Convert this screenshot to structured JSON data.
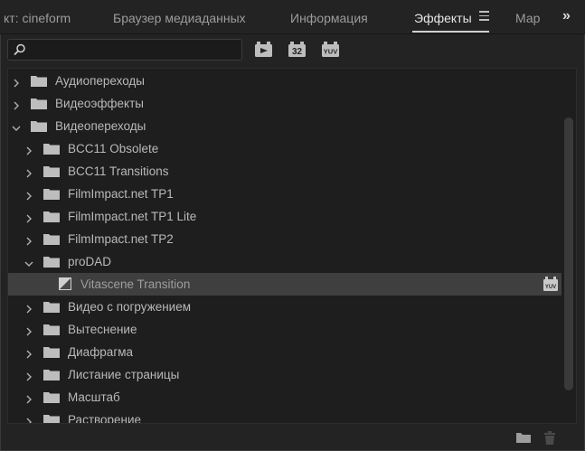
{
  "tabs": [
    {
      "label": "кт: cineform",
      "active": false
    },
    {
      "label": "Браузер медиаданных",
      "active": false
    },
    {
      "label": "Информация",
      "active": false
    },
    {
      "label": "Эффекты",
      "active": true
    },
    {
      "label": "Мар",
      "active": false
    }
  ],
  "more_tabs_glyph": "»",
  "search": {
    "value": "",
    "placeholder": ""
  },
  "toolbar": {
    "accelerated_icon": "accelerated-effects-icon",
    "bit32_label": "32",
    "yuv_label": "YUV"
  },
  "tree": [
    {
      "label": "Аудиопереходы",
      "expanded": false,
      "type": "folder"
    },
    {
      "label": "Видеоэффекты",
      "expanded": false,
      "type": "folder"
    },
    {
      "label": "Видеопереходы",
      "expanded": true,
      "type": "folder"
    },
    {
      "label": "BCC11 Obsolete",
      "expanded": false,
      "type": "folder"
    },
    {
      "label": "BCC11 Transitions",
      "expanded": false,
      "type": "folder"
    },
    {
      "label": "FilmImpact.net TP1",
      "expanded": false,
      "type": "folder"
    },
    {
      "label": "FilmImpact.net TP1 Lite",
      "expanded": false,
      "type": "folder"
    },
    {
      "label": "FilmImpact.net TP2",
      "expanded": false,
      "type": "folder"
    },
    {
      "label": "proDAD",
      "expanded": true,
      "type": "folder"
    },
    {
      "label": "Vitascene Transition",
      "type": "effect",
      "selected": true,
      "badge": "YUV"
    },
    {
      "label": "Видео с погружением",
      "expanded": false,
      "type": "folder"
    },
    {
      "label": "Вытеснение",
      "expanded": false,
      "type": "folder"
    },
    {
      "label": "Диафрагма",
      "expanded": false,
      "type": "folder"
    },
    {
      "label": "Листание страницы",
      "expanded": false,
      "type": "folder"
    },
    {
      "label": "Масштаб",
      "expanded": false,
      "type": "folder"
    },
    {
      "label": "Растворение",
      "expanded": false,
      "type": "folder"
    }
  ],
  "bottom": {
    "new_folder_icon": "new-folder-icon",
    "delete_icon": "trash-icon"
  }
}
